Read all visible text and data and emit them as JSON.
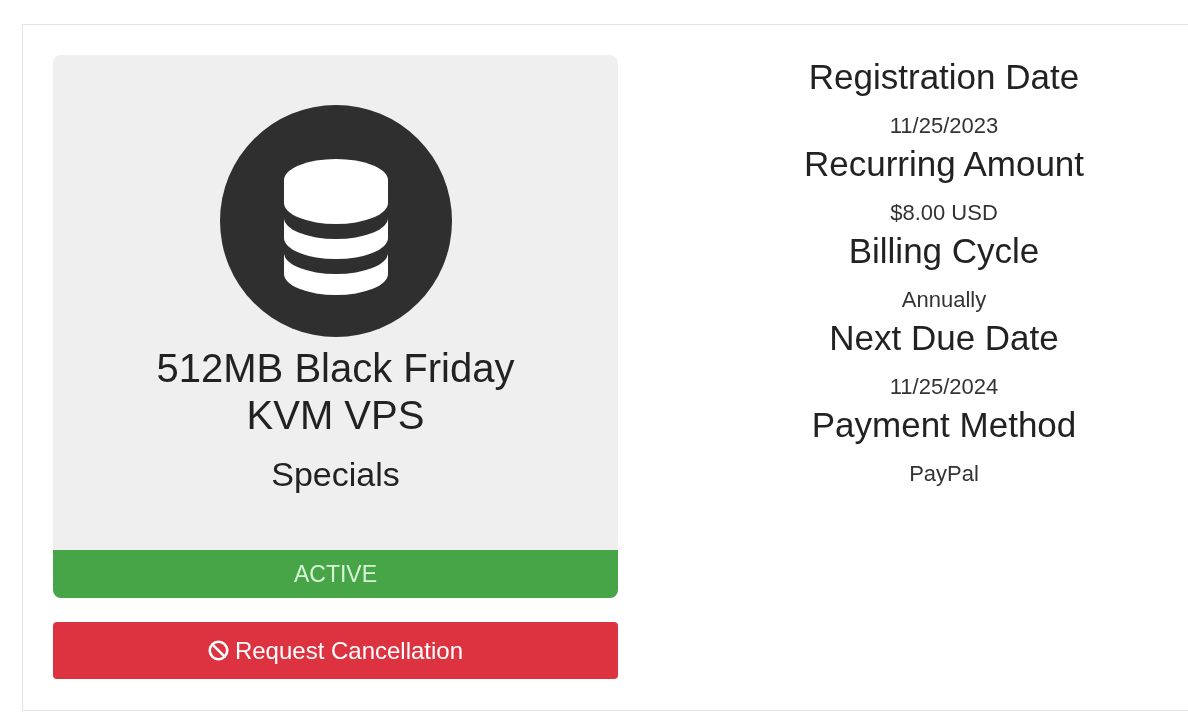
{
  "product": {
    "name": "512MB Black Friday KVM VPS",
    "group": "Specials",
    "status": {
      "label": "ACTIVE",
      "kind": "active"
    }
  },
  "cancel_button": {
    "label": "Request Cancellation"
  },
  "details": [
    {
      "label": "Registration Date",
      "value": "11/25/2023"
    },
    {
      "label": "Recurring Amount",
      "value": "$8.00 USD"
    },
    {
      "label": "Billing Cycle",
      "value": "Annually"
    },
    {
      "label": "Next Due Date",
      "value": "11/25/2024"
    },
    {
      "label": "Payment Method",
      "value": "PayPal"
    }
  ]
}
